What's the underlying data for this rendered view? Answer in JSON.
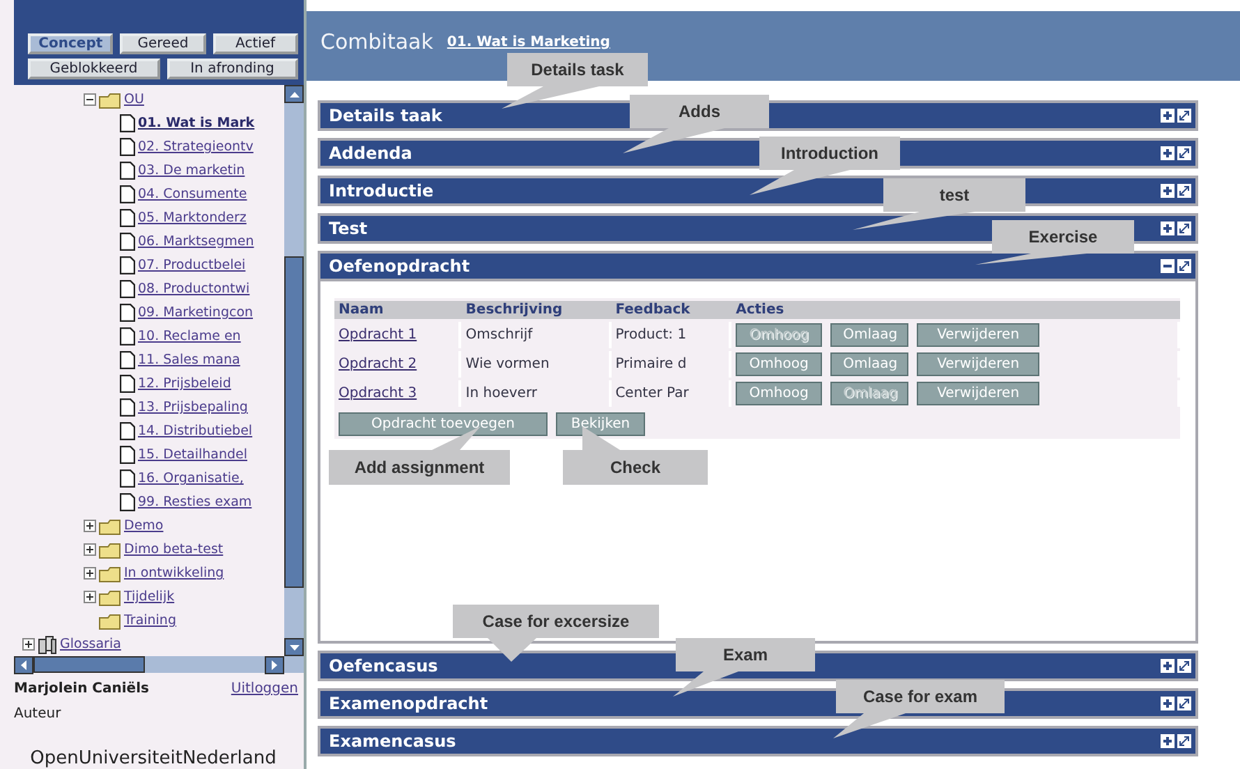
{
  "status_filters": [
    {
      "label": "Concept",
      "selected": true
    },
    {
      "label": "Gereed",
      "selected": false
    },
    {
      "label": "Actief",
      "selected": false
    },
    {
      "label": "Geblokkeerd",
      "selected": false
    },
    {
      "label": "In afronding",
      "selected": false
    }
  ],
  "tree": [
    {
      "label": "OU",
      "kind": "folder",
      "expanded": true,
      "children": [
        {
          "label": "01. Wat is Mark",
          "kind": "page",
          "selected": true
        },
        {
          "label": "02. Strategieontv",
          "kind": "page",
          "selected": false
        },
        {
          "label": "03. De marketin",
          "kind": "page",
          "selected": false
        },
        {
          "label": "04. Consumente",
          "kind": "page",
          "selected": false
        },
        {
          "label": "05. Marktonderz",
          "kind": "page",
          "selected": false
        },
        {
          "label": "06. Marktsegmen",
          "kind": "page",
          "selected": false
        },
        {
          "label": "07. Productbelei",
          "kind": "page",
          "selected": false
        },
        {
          "label": "08. Productontwi",
          "kind": "page",
          "selected": false
        },
        {
          "label": "09. Marketingcon",
          "kind": "page",
          "selected": false
        },
        {
          "label": "10. Reclame en",
          "kind": "page",
          "selected": false
        },
        {
          "label": "11. Sales mana",
          "kind": "page",
          "selected": false
        },
        {
          "label": "12. Prijsbeleid",
          "kind": "page",
          "selected": false
        },
        {
          "label": "13. Prijsbepaling",
          "kind": "page",
          "selected": false
        },
        {
          "label": "14. Distributiebel",
          "kind": "page",
          "selected": false
        },
        {
          "label": "15. Detailhandel",
          "kind": "page",
          "selected": false
        },
        {
          "label": "16. Organisatie,",
          "kind": "page",
          "selected": false
        },
        {
          "label": "99. Resties exam",
          "kind": "page",
          "selected": false
        }
      ]
    },
    {
      "label": "Demo",
      "kind": "folder",
      "expanded": false
    },
    {
      "label": "Dimo beta-test",
      "kind": "folder",
      "expanded": false
    },
    {
      "label": "In ontwikkeling",
      "kind": "folder",
      "expanded": false
    },
    {
      "label": "Tijdelijk",
      "kind": "folder",
      "expanded": false
    },
    {
      "label": "Training",
      "kind": "empty-folder"
    },
    {
      "label": "Glossaria",
      "kind": "glossary",
      "expanded": false
    }
  ],
  "user": {
    "name": "Marjolein Caniëls",
    "role": "Auteur",
    "logout": "Uitloggen"
  },
  "logo": "OpenUniversiteitNederland",
  "header": {
    "title": "Combitaak",
    "link": "01. Wat is Marketing"
  },
  "sections": [
    {
      "title": "Details taak",
      "expanded": false
    },
    {
      "title": "Addenda",
      "expanded": false
    },
    {
      "title": "Introductie",
      "expanded": false
    },
    {
      "title": "Test",
      "expanded": false
    },
    {
      "title": "Oefenopdracht",
      "expanded": true,
      "table": {
        "columns": [
          "Naam",
          "Beschrijving",
          "Feedback",
          "Acties"
        ],
        "rows": [
          {
            "name": "Opdracht 1",
            "description": "Omschrijf",
            "feedback": "Product: 1",
            "actions": [
              {
                "label": "Omhoog",
                "disabled": true
              },
              {
                "label": "Omlaag",
                "disabled": false
              },
              {
                "label": "Verwijderen",
                "disabled": false
              }
            ]
          },
          {
            "name": "Opdracht 2",
            "description": "Wie vormen",
            "feedback": "Primaire d",
            "actions": [
              {
                "label": "Omhoog",
                "disabled": false
              },
              {
                "label": "Omlaag",
                "disabled": false
              },
              {
                "label": "Verwijderen",
                "disabled": false
              }
            ]
          },
          {
            "name": "Opdracht 3",
            "description": "In hoeverr",
            "feedback": "Center Par",
            "actions": [
              {
                "label": "Omhoog",
                "disabled": false
              },
              {
                "label": "Omlaag",
                "disabled": true
              },
              {
                "label": "Verwijderen",
                "disabled": false
              }
            ]
          }
        ],
        "buttons": [
          "Opdracht toevoegen",
          "Bekijken"
        ]
      }
    },
    {
      "title": "Oefencasus",
      "expanded": false
    },
    {
      "title": "Examenopdracht",
      "expanded": false
    },
    {
      "title": "Examencasus",
      "expanded": false
    }
  ],
  "callouts": [
    "Details task",
    "Adds",
    "Introduction",
    "test",
    "Exercise",
    "Add assignment",
    "Check",
    "Case for excersize",
    "Exam",
    "Case for exam"
  ]
}
